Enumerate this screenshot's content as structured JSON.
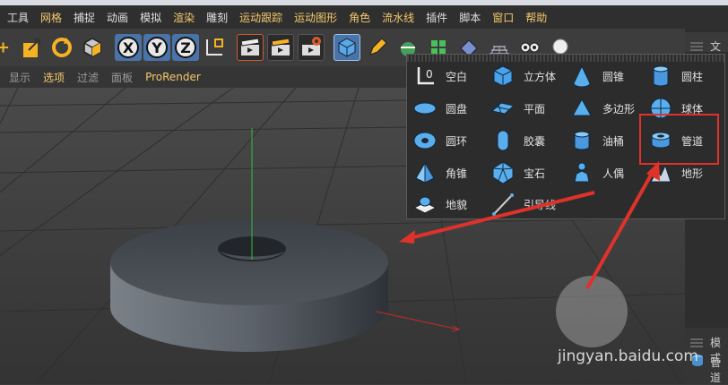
{
  "menubar": {
    "items": [
      "工具",
      "网格",
      "捕捉",
      "动画",
      "模拟",
      "渲染",
      "雕刻",
      "运动跟踪",
      "运动图形",
      "角色",
      "流水线",
      "插件",
      "脚本",
      "窗口",
      "帮助"
    ],
    "highlighted": [
      "网格",
      "渲染",
      "运动跟踪",
      "运动图形",
      "角色",
      "流水线",
      "窗口",
      "帮助"
    ]
  },
  "toolbar": {
    "axis_x": "X",
    "axis_y": "Y",
    "axis_z": "Z"
  },
  "viewbar": {
    "items": [
      "显示",
      "选项",
      "过滤",
      "面板",
      "ProRender"
    ],
    "active": "选项"
  },
  "primitives_menu": {
    "items": [
      {
        "label": "空白",
        "icon": "null-object-icon"
      },
      {
        "label": "立方体",
        "icon": "cube-icon"
      },
      {
        "label": "圆锥",
        "icon": "cone-icon"
      },
      {
        "label": "圆柱",
        "icon": "cylinder-icon"
      },
      {
        "label": "圆盘",
        "icon": "disc-icon"
      },
      {
        "label": "平面",
        "icon": "plane-icon"
      },
      {
        "label": "多边形",
        "icon": "polygon-icon"
      },
      {
        "label": "球体",
        "icon": "sphere-icon"
      },
      {
        "label": "圆环",
        "icon": "torus-icon"
      },
      {
        "label": "胶囊",
        "icon": "capsule-icon"
      },
      {
        "label": "油桶",
        "icon": "oil-tank-icon"
      },
      {
        "label": "管道",
        "icon": "tube-icon"
      },
      {
        "label": "角锥",
        "icon": "pyramid-icon"
      },
      {
        "label": "宝石",
        "icon": "platonic-icon"
      },
      {
        "label": "人偶",
        "icon": "figure-icon"
      },
      {
        "label": "地形",
        "icon": "landscape-icon"
      },
      {
        "label": "地貌",
        "icon": "relief-icon"
      },
      {
        "label": "引导线",
        "icon": "guide-icon"
      }
    ],
    "highlighted_item": "管道"
  },
  "right_panel": {
    "top_label": "文件",
    "lower_label": "模式",
    "object_label": "管道"
  },
  "watermark": "jingyan.baidu.com",
  "colors": {
    "accent": "#f5c96b",
    "axis_blue": "#4a74a8",
    "annotation_red": "#e0322a"
  }
}
